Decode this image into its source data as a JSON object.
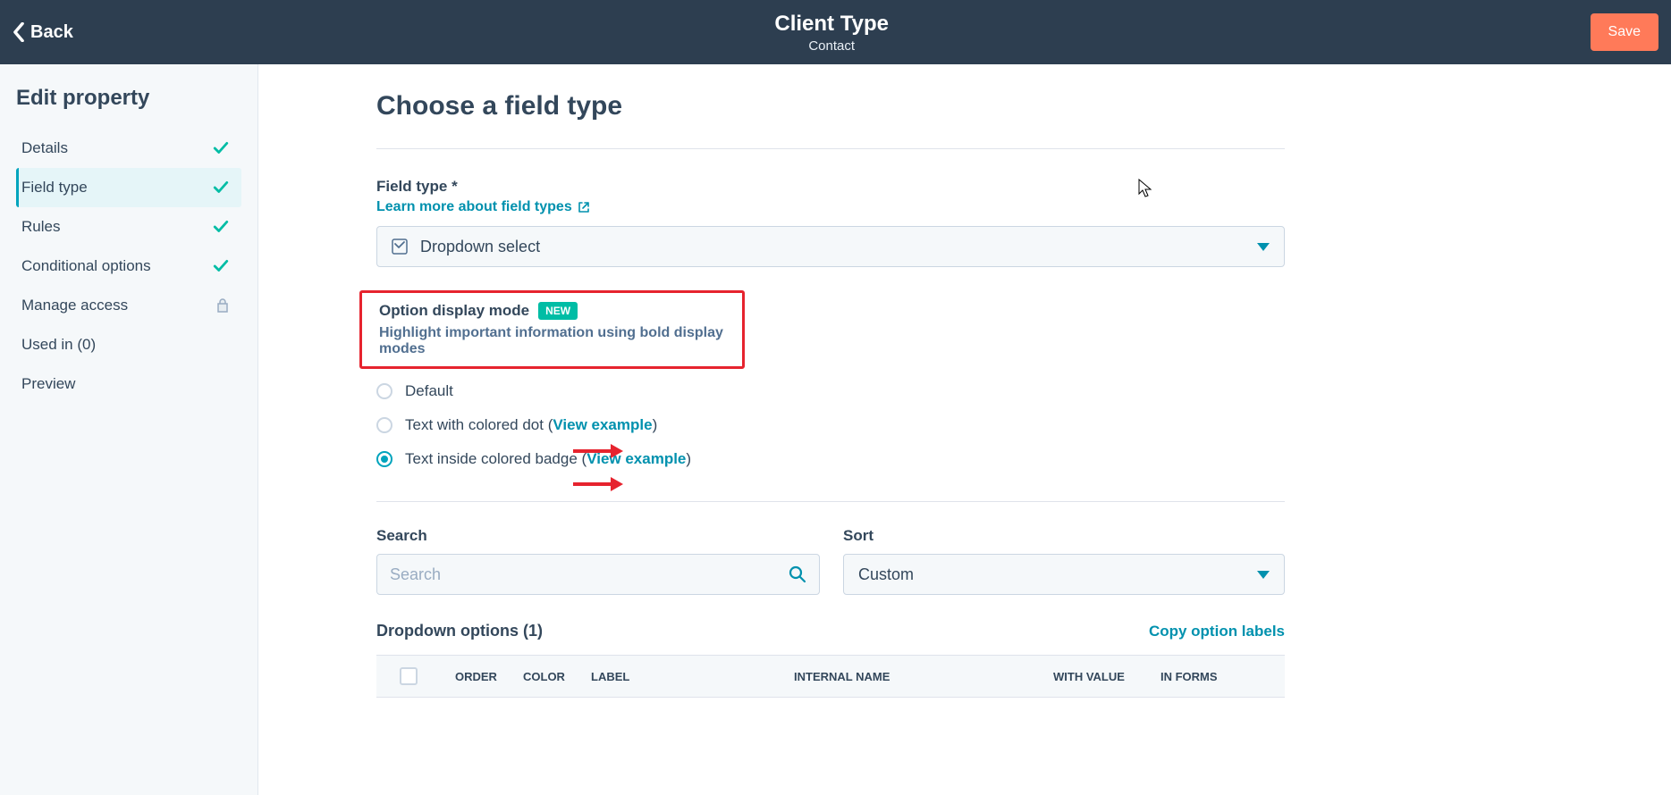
{
  "topbar": {
    "back_label": "Back",
    "title": "Client Type",
    "subtitle": "Contact",
    "save_label": "Save"
  },
  "sidebar": {
    "heading": "Edit property",
    "items": [
      {
        "label": "Details",
        "status": "check"
      },
      {
        "label": "Field type",
        "status": "check",
        "active": true
      },
      {
        "label": "Rules",
        "status": "check"
      },
      {
        "label": "Conditional options",
        "status": "check"
      },
      {
        "label": "Manage access",
        "status": "lock"
      },
      {
        "label": "Used in (0)",
        "status": ""
      },
      {
        "label": "Preview",
        "status": ""
      }
    ]
  },
  "main": {
    "heading": "Choose a field type",
    "field_type": {
      "label": "Field type *",
      "learn_more": "Learn more about field types",
      "value": "Dropdown select"
    },
    "display_mode": {
      "label": "Option display mode",
      "new_badge": "NEW",
      "desc": "Highlight important information using bold display modes",
      "options": [
        {
          "label": "Default",
          "link": "",
          "selected": false
        },
        {
          "label": "Text with colored dot (",
          "link": "View example",
          "suffix": ")",
          "selected": false
        },
        {
          "label": "Text inside colored badge (",
          "link": "View example",
          "suffix": ")",
          "selected": true
        }
      ]
    },
    "search": {
      "label": "Search",
      "placeholder": "Search"
    },
    "sort": {
      "label": "Sort",
      "value": "Custom"
    },
    "options_table": {
      "title": "Dropdown options (1)",
      "copy_link": "Copy option labels",
      "columns": {
        "order": "ORDER",
        "color": "COLOR",
        "label": "LABEL",
        "internal": "INTERNAL NAME",
        "withval": "WITH VALUE",
        "informs": "IN FORMS"
      }
    }
  }
}
